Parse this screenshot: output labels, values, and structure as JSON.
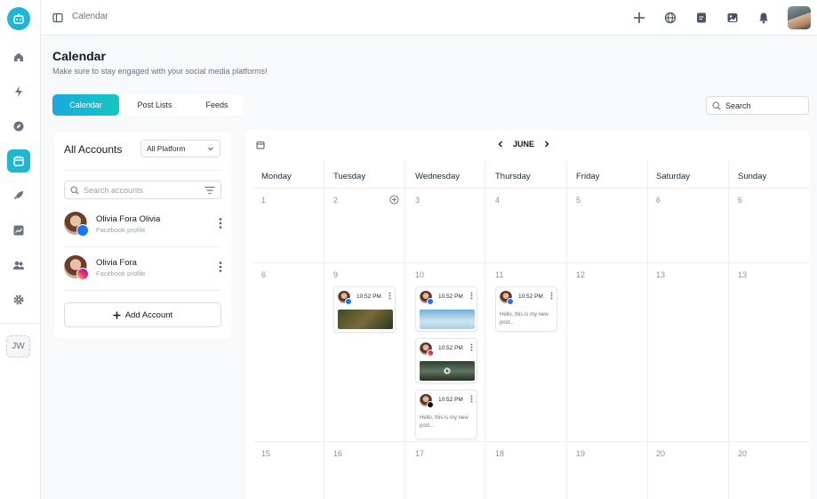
{
  "topbar": {
    "breadcrumb": "Calendar"
  },
  "sidebar": {
    "initials": "JW"
  },
  "page": {
    "title": "Calendar",
    "subtitle": "Make sure to stay engaged with your social media platforms!"
  },
  "tabs": [
    "Calendar",
    "Post Lists",
    "Feeds"
  ],
  "search": {
    "placeholder": "Search"
  },
  "accounts": {
    "heading": "All Accounts",
    "platform_filter": "All Platform",
    "search_placeholder": "Search accounts",
    "items": [
      {
        "name": "Olivia Fora Olivia",
        "kind": "Facebook profile",
        "network": "facebook"
      },
      {
        "name": "Olivia Fora",
        "kind": "Facebook profile",
        "network": "instagram"
      }
    ],
    "add_label": "Add Account"
  },
  "calendar": {
    "month": "JUNE",
    "days": [
      "Monday",
      "Tuesday",
      "Wednesday",
      "Thursday",
      "Friday",
      "Saturday",
      "Sunday"
    ],
    "weeks": [
      [
        "1",
        "2",
        "3",
        "4",
        "5",
        "6",
        "6"
      ],
      [
        "6",
        "9",
        "10",
        "11",
        "12",
        "13",
        "13"
      ],
      [
        "15",
        "16",
        "17",
        "18",
        "19",
        "20",
        "20"
      ]
    ],
    "posts": {
      "tue": [
        {
          "time": "10:52 PM",
          "network": "facebook",
          "media": "photo-forest"
        }
      ],
      "wed": [
        {
          "time": "10:52 PM",
          "network": "facebook",
          "media": "photo-sky"
        },
        {
          "time": "10:52 PM",
          "network": "instagram",
          "media": "video-forest"
        },
        {
          "time": "10:52 PM",
          "network": "x",
          "text": "Hello, this is my new post..."
        }
      ],
      "thu": [
        {
          "time": "10:52 PM",
          "network": "facebook",
          "text": "Hello, this is my new post..."
        }
      ]
    }
  },
  "colors": {
    "accent": "#1fb6d6",
    "tab_gradient_start": "#1ca8df",
    "tab_gradient_end": "#14c7c1",
    "facebook": "#1877f2"
  }
}
